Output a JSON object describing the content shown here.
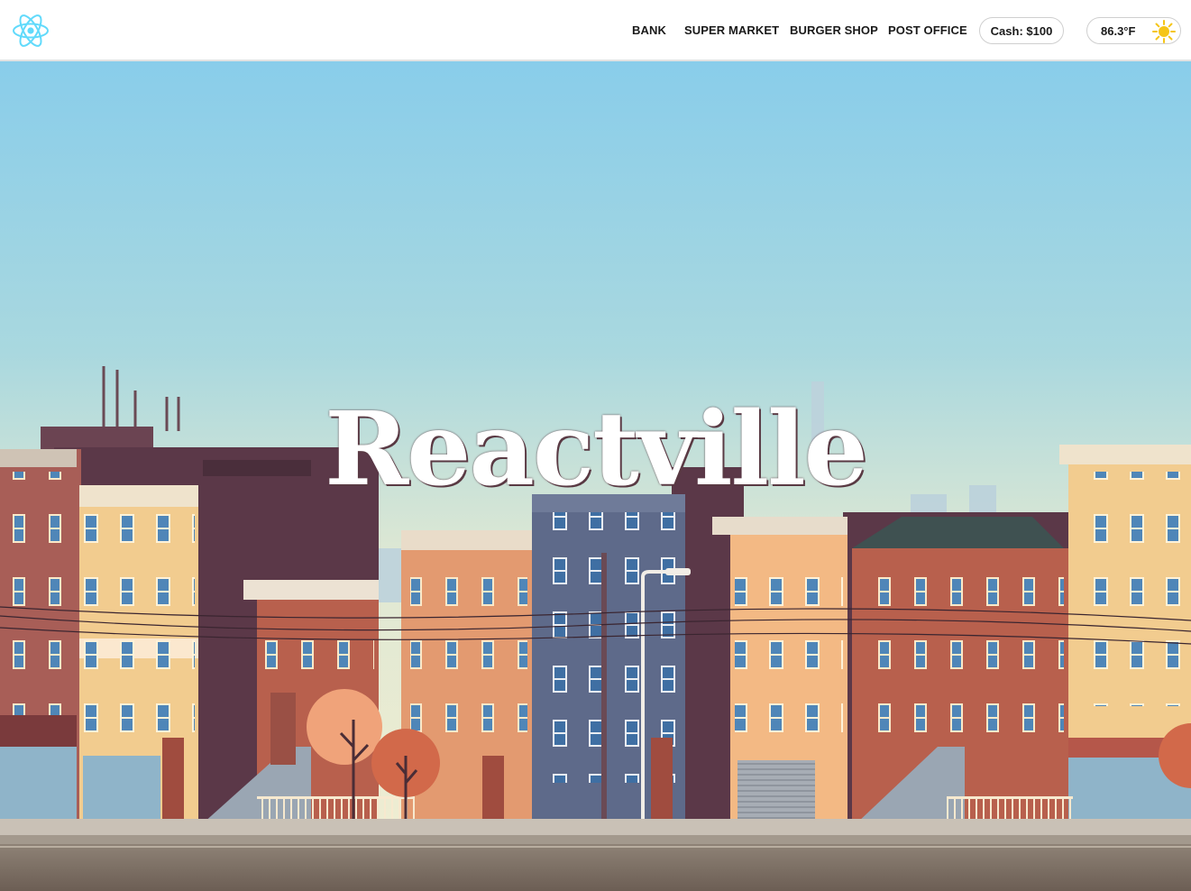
{
  "nav": {
    "logo_icon": "react-atom-icon",
    "links": [
      "BANK",
      "SUPER MARKET",
      "BURGER SHOP",
      "POST OFFICE"
    ],
    "cash": "Cash: $100",
    "weather": {
      "temperature": "86.3°F",
      "icon": "sun-icon"
    }
  },
  "hero": {
    "title": "Reactville"
  },
  "colors": {
    "accent": "#61dafb",
    "sun": "#f5c518",
    "sky_top": "#89cdea",
    "sky_bottom": "#eef0d6"
  }
}
